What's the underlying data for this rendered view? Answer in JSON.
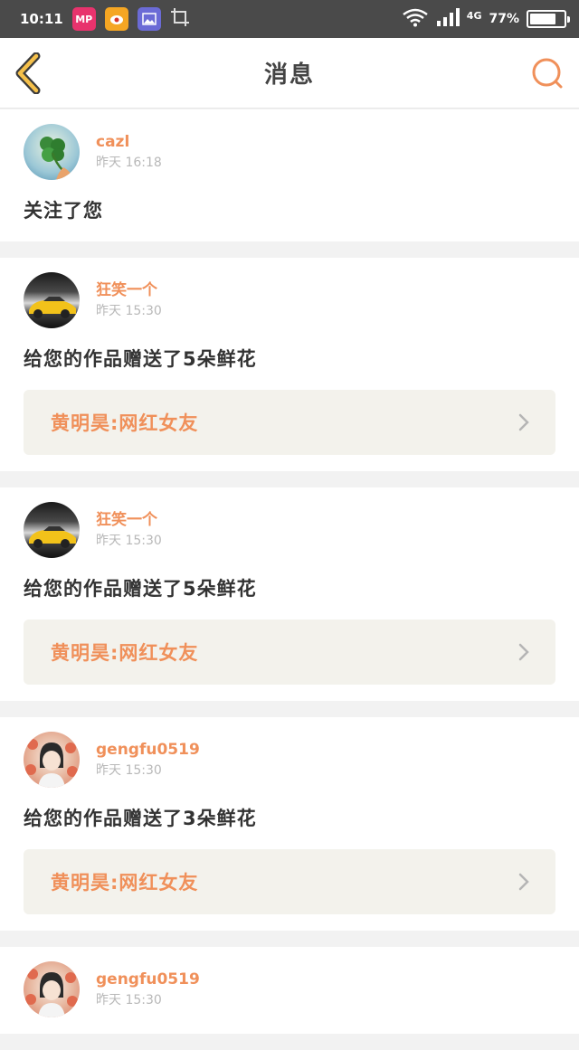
{
  "status_bar": {
    "time": "10:11",
    "network": "4G",
    "battery": "77%",
    "battery_level": 0.77,
    "apps": [
      {
        "name": "MP",
        "color": "#e8336d"
      },
      {
        "name": "weibo",
        "color": "#f5a623"
      },
      {
        "name": "gallery",
        "color": "#6b6bd6"
      }
    ]
  },
  "header": {
    "title": "消息",
    "accent": "#f0905a"
  },
  "messages": [
    {
      "author": "cazl",
      "time": "昨天 16:18",
      "text": "关注了您",
      "avatar": "clover-avatar"
    },
    {
      "author": "狂笑一个",
      "time": "昨天 15:30",
      "text": "给您的作品赠送了5朵鲜花",
      "link": "黄明昊:网红女友",
      "avatar": "car-avatar"
    },
    {
      "author": "狂笑一个",
      "time": "昨天 15:30",
      "text": "给您的作品赠送了5朵鲜花",
      "link": "黄明昊:网红女友",
      "avatar": "car-avatar"
    },
    {
      "author": "gengfu0519",
      "time": "昨天 15:30",
      "text": "给您的作品赠送了3朵鲜花",
      "link": "黄明昊:网红女友",
      "avatar": "girl-avatar"
    },
    {
      "author": "gengfu0519",
      "time": "昨天 15:30",
      "avatar": "girl-avatar"
    }
  ]
}
